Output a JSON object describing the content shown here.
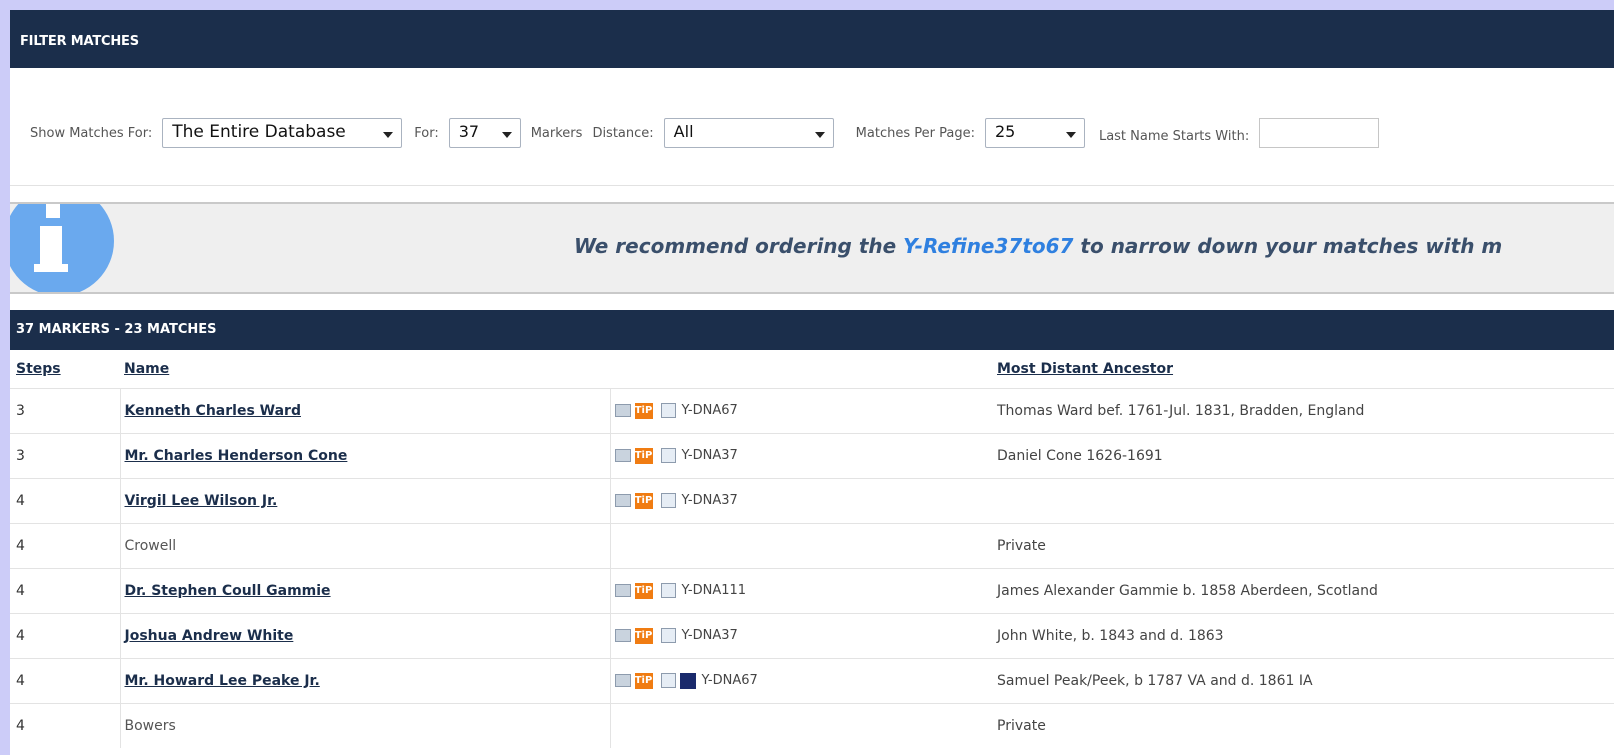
{
  "filter_panel": {
    "title": "FILTER MATCHES"
  },
  "filters": {
    "show_for_label": "Show Matches For:",
    "show_for_value": "The Entire Database",
    "for_label": "For:",
    "for_value": "37",
    "markers_label": "Markers",
    "distance_label": "Distance:",
    "distance_value": "All",
    "per_page_label": "Matches Per Page:",
    "per_page_value": "25",
    "last_name_label": "Last Name Starts With:",
    "last_name_value": ""
  },
  "info": {
    "text_pre": "We recommend ordering the ",
    "link": "Y-Refine37to67",
    "text_post": " to narrow down your matches with m"
  },
  "results": {
    "title": "37 MARKERS - 23 MATCHES",
    "columns": {
      "steps": "Steps",
      "name": "Name",
      "ancestor": "Most Distant Ancestor"
    },
    "rows": [
      {
        "steps": "3",
        "name": "Kenneth Charles Ward",
        "linked": true,
        "kit": "Y-DNA67",
        "ancestor": "Thomas Ward bef. 1761-Jul. 1831, Bradden, England"
      },
      {
        "steps": "3",
        "name": "Mr. Charles Henderson Cone",
        "linked": true,
        "kit": "Y-DNA37",
        "ancestor": "Daniel Cone 1626-1691"
      },
      {
        "steps": "4",
        "name": "Virgil Lee Wilson Jr.",
        "linked": true,
        "kit": "Y-DNA37",
        "ancestor": ""
      },
      {
        "steps": "4",
        "name": "Crowell",
        "linked": false,
        "kit": "",
        "ancestor": "Private"
      },
      {
        "steps": "4",
        "name": "Dr. Stephen Coull Gammie",
        "linked": true,
        "kit": "Y-DNA111",
        "ancestor": "James Alexander Gammie b. 1858 Aberdeen, Scotland"
      },
      {
        "steps": "4",
        "name": "Joshua Andrew White",
        "linked": true,
        "kit": "Y-DNA37",
        "ancestor": "John White, b. 1843 and d. 1863"
      },
      {
        "steps": "4",
        "name": "Mr. Howard Lee Peake Jr.",
        "linked": true,
        "tree": true,
        "kit": "Y-DNA67",
        "ancestor": "Samuel Peak/Peek, b 1787 VA and d. 1861 IA"
      },
      {
        "steps": "4",
        "name": "Bowers",
        "linked": false,
        "kit": "",
        "ancestor": "Private"
      }
    ]
  },
  "icons": {
    "email": "email-icon",
    "tip": "tip-icon",
    "note": "notes-icon",
    "tree": "family-tree-icon",
    "info": "info-icon"
  },
  "colors": {
    "header_bg": "#1b2e4b",
    "page_bg": "#ccccf8",
    "link": "#2f80e0",
    "tip": "#f07c12",
    "info_icon": "#6aa9ee"
  }
}
